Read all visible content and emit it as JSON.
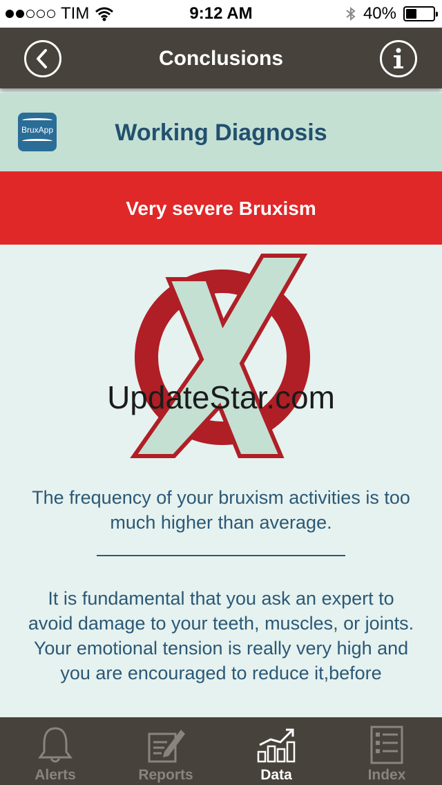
{
  "status_bar": {
    "carrier": "TIM",
    "time": "9:12 AM",
    "battery": "40%",
    "battery_fraction": 0.4
  },
  "nav": {
    "title": "Conclusions"
  },
  "header": {
    "logo_text": "BruxApp",
    "title": "Working Diagnosis"
  },
  "severity": {
    "label": "Very severe Bruxism"
  },
  "watermark": "UpdateStar.com",
  "messages": {
    "frequency": "The frequency of your bruxism activities is too much higher than average.",
    "advice": "It is fundamental that you ask an expert to avoid damage to your teeth, muscles, or joints. Your emotional tension is really very high and you are encouraged to reduce it,before"
  },
  "tabs": [
    {
      "label": "Alerts",
      "icon": "bell-icon",
      "active": false
    },
    {
      "label": "Reports",
      "icon": "edit-report-icon",
      "active": false
    },
    {
      "label": "Data",
      "icon": "bar-chart-icon",
      "active": true
    },
    {
      "label": "Index",
      "icon": "list-icon",
      "active": false
    }
  ],
  "colors": {
    "nav": "#47433c",
    "header_bg": "#c3e0d3",
    "severity_red": "#e02828",
    "text_blue": "#2b5876",
    "heading_blue": "#23506f",
    "mark_red": "#b01e26",
    "mark_fill": "#c3e0d3",
    "background": "#e6f2ef"
  }
}
